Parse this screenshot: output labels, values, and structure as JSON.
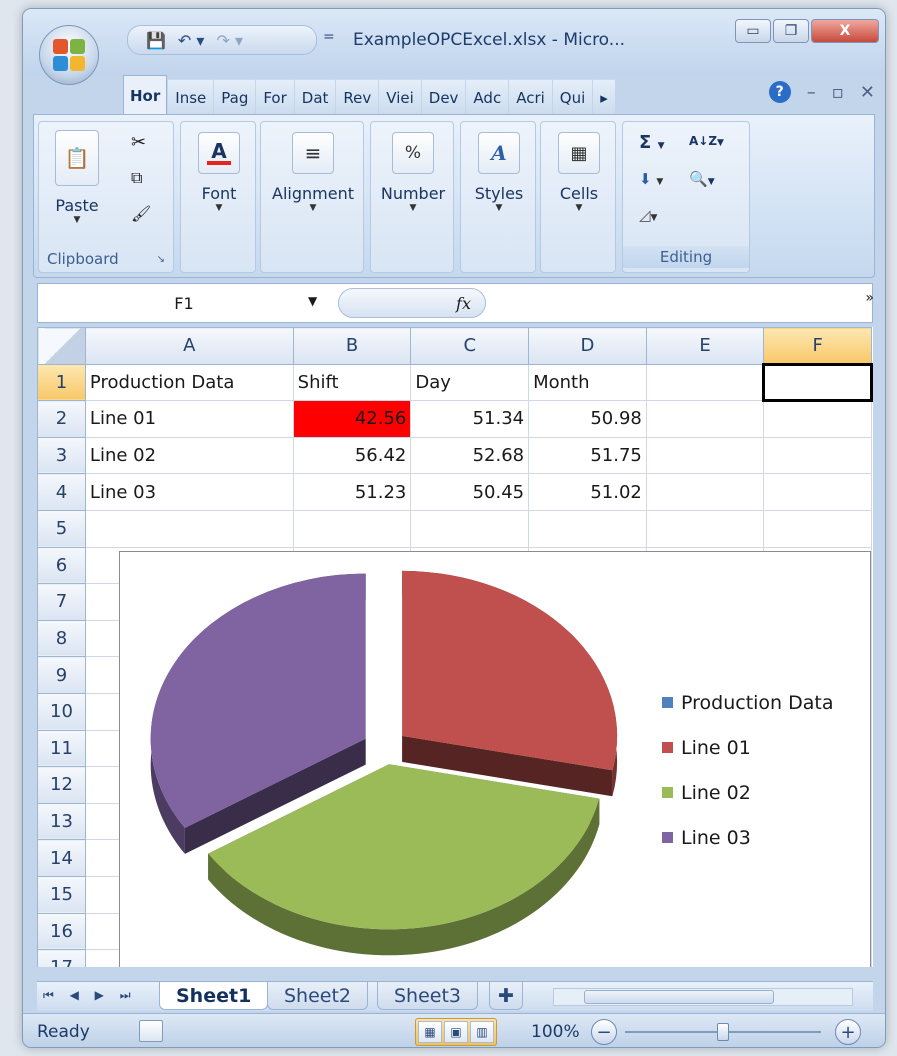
{
  "window": {
    "title": "ExampleOPCExcel.xlsx - Micro...",
    "minimize_glyph": "▭",
    "restore_glyph": "❐",
    "close_glyph": "X"
  },
  "qat": {
    "save_icon": "save-icon",
    "undo_icon": "undo-icon",
    "redo_icon": "redo-icon",
    "more_glyph": "="
  },
  "tabs": [
    "Hor",
    "Inse",
    "Pag",
    "For",
    "Dat",
    "Rev",
    "Viei",
    "Dev",
    "Adc",
    "Acri",
    "Qui"
  ],
  "tabs_more": "▸",
  "help_glyph": "?",
  "ribbon": {
    "clipboard": {
      "paste_label": "Paste",
      "group_label": "Clipboard"
    },
    "font": {
      "label": "Font"
    },
    "alignment": {
      "label": "Alignment"
    },
    "number": {
      "label": "Number",
      "icon_text": "%"
    },
    "styles": {
      "label": "Styles"
    },
    "cells": {
      "label": "Cells"
    },
    "editing": {
      "label": "Editing",
      "sum_glyph": "Σ",
      "sort_glyph": "A↓Z",
      "find_glyph": "🔍",
      "fill_glyph": "⬇",
      "clear_glyph": "◿"
    }
  },
  "formula_bar": {
    "name_box": "F1",
    "fx": "fx",
    "value": "",
    "expand_glyph": "»"
  },
  "grid": {
    "columns": [
      "A",
      "B",
      "C",
      "D",
      "E",
      "F"
    ],
    "row_numbers": [
      "1",
      "2",
      "3",
      "4",
      "5",
      "6",
      "7",
      "8",
      "9",
      "10",
      "11",
      "12",
      "13",
      "14",
      "15",
      "16",
      "17"
    ],
    "rows": [
      [
        "Production Data",
        "Shift",
        "Day",
        "Month",
        "",
        ""
      ],
      [
        "Line 01",
        "42.56",
        "51.34",
        "50.98",
        "",
        ""
      ],
      [
        "Line 02",
        "56.42",
        "52.68",
        "51.75",
        "",
        ""
      ],
      [
        "Line 03",
        "51.23",
        "50.45",
        "51.02",
        "",
        ""
      ]
    ],
    "highlight_color": "#ff0000",
    "active_cell": "F1"
  },
  "chart_data": {
    "type": "pie",
    "categories": [
      "Production Data",
      "Line 01",
      "Line 02",
      "Line 03"
    ],
    "values": [
      0,
      42.56,
      56.42,
      51.23
    ],
    "colors": [
      "#4f81bd",
      "#c0504d",
      "#9bbb59",
      "#8064a2"
    ],
    "exploded": true,
    "three_d": true,
    "legend": "right"
  },
  "sheets": {
    "tabs": [
      "Sheet1",
      "Sheet2",
      "Sheet3"
    ],
    "active": "Sheet1",
    "nav_glyphs": "⏮ ◀ ▶ ⏭"
  },
  "status": {
    "ready": "Ready",
    "zoom": "100%",
    "zoom_minus": "−",
    "zoom_plus": "+",
    "zoom_level": 0.5
  }
}
